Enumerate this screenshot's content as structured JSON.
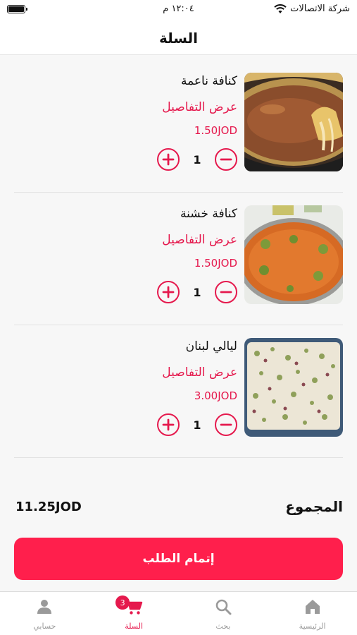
{
  "status_bar": {
    "carrier": "شركة الاتصالات",
    "time": "١٢:٠٤ م"
  },
  "header": {
    "title": "السلة"
  },
  "cart": {
    "items": [
      {
        "name": "كنافة ناعمة",
        "details_label": "عرض التفاصيل",
        "price": "1.50JOD",
        "quantity": "1",
        "image": "kunafa-naema-photo"
      },
      {
        "name": "كنافة خشنة",
        "details_label": "عرض التفاصيل",
        "price": "1.50JOD",
        "quantity": "1",
        "image": "kunafa-khishneh-photo"
      },
      {
        "name": "ليالي لبنان",
        "details_label": "عرض التفاصيل",
        "price": "3.00JOD",
        "quantity": "1",
        "image": "layali-lubnan-photo"
      }
    ],
    "plus_icon": "plus-circle-icon",
    "minus_icon": "minus-circle-icon"
  },
  "summary": {
    "total_label": "المجموع",
    "total_amount": "11.25JOD"
  },
  "checkout": {
    "label": "إتمام الطلب"
  },
  "tabs": [
    {
      "label": "الرئيسية",
      "icon": "home-icon",
      "active": false
    },
    {
      "label": "بحث",
      "icon": "search-icon",
      "active": false
    },
    {
      "label": "السلة",
      "icon": "cart-icon",
      "active": true,
      "badge": "3"
    },
    {
      "label": "حسابي",
      "icon": "user-icon",
      "active": false
    }
  ],
  "colors": {
    "accent": "#e5194d",
    "button": "#ff1f4c",
    "inactive_tab": "#9a9a9a"
  }
}
